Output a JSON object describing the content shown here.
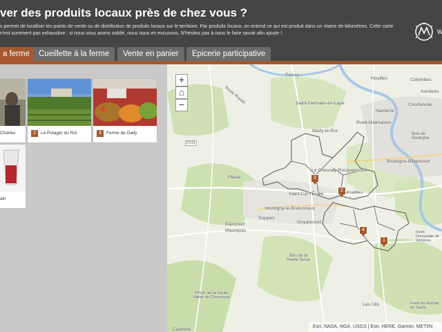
{
  "header": {
    "title": "ver des produits locaux près de chez vous ?",
    "description": "s permet de localiser les points de vente ou de distribution de produits locaux sur le territoire. Par produits locaux, on entend ce qui est produit dans un ntaine de kilomètres. Cette carte n'est surement pas exhaustive : si nous vous avons oublié, nous nous en excusons. N'hésitez pas à nous le faire savoir afin ajoute !",
    "logo_text": "W"
  },
  "tabs": [
    {
      "label": "a ferme",
      "active": true
    },
    {
      "label": "Cueillette à la ferme",
      "active": false
    },
    {
      "label": "Vente en panier",
      "active": false
    },
    {
      "label": "Epicerie participative",
      "active": false
    }
  ],
  "cards": [
    {
      "num": "",
      "label": "Charles"
    },
    {
      "num": "2",
      "label": "Le Potager du Roi"
    },
    {
      "num": "3",
      "label": "Ferme de Gally"
    },
    {
      "num": "",
      "label": "ain"
    }
  ],
  "map": {
    "zoom_in": "+",
    "home": "⌂",
    "zoom_out": "−",
    "attribution": "Esri, NASA, NGA, USGS | Esri, HERE, Garmin, METI/N",
    "road_label": "D191",
    "places": [
      "Poissy",
      "Houilles",
      "Colombes",
      "Asnières",
      "Saint-Germain-en-Laye",
      "Nanterre",
      "Courbevoie",
      "Rueil-Malmaison",
      "Marly-le-Roi",
      "Bois de Boulogne",
      "Route Royale",
      "Boulogne-Billancourt",
      "Le Chesnay-Rocquencourt",
      "Plaisir",
      "Saint-Cyr-l'École",
      "Versailles",
      "Montigny-le-Bretonneux",
      "Trappes",
      "Guyancourt",
      "Élancourt",
      "Maurepas",
      "Bois de la Haute-Tasse",
      "Forêt Domaniale de Verrières",
      "P.N.R. de la Haute Vallée de Chevreuse",
      "Les Ulis",
      "Forêt du Rocher de Saulx",
      "Clairbois"
    ],
    "markers": [
      "3",
      "2",
      "4",
      "1"
    ]
  },
  "colors": {
    "accent": "#a5582f",
    "header": "#444444",
    "tab": "#6b6b6b"
  }
}
